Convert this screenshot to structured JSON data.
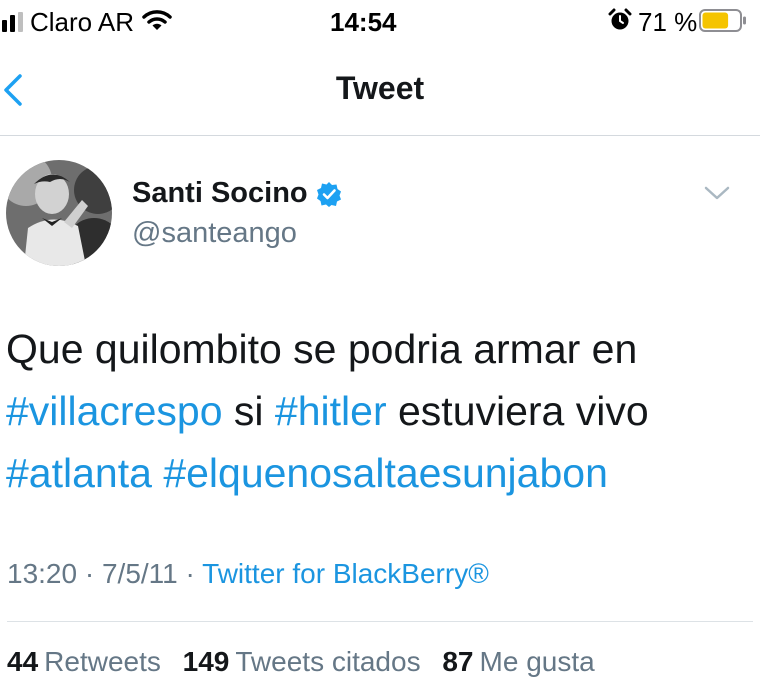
{
  "status_bar": {
    "carrier": "Claro AR",
    "time": "14:54",
    "battery_percent": "71 %",
    "battery_level": 0.71,
    "battery_color": "#f5c400",
    "icons": [
      "signal-icon",
      "wifi-icon",
      "alarm-icon",
      "battery-icon"
    ]
  },
  "nav": {
    "title": "Tweet",
    "back_icon": "chevron-left-icon",
    "accent": "#1da1f2"
  },
  "tweet": {
    "author_name": "Santi Socino",
    "verified": true,
    "handle": "@santeango",
    "text": {
      "line1": "Que quilombito se podria armar en",
      "hashtag_villacrespo": "#villacrespo",
      "word_si": "si",
      "hashtag_hitler": "#hitler",
      "rest_line2": "estuviera vivo",
      "hashtag_atlanta": "#atlanta",
      "hashtag_elqueno": "#elquenosaltaesunjabon"
    },
    "time": "13:20",
    "date": "7/5/11",
    "source": "Twitter for BlackBerry®",
    "hashtag_color": "#1b95e0"
  },
  "stats": {
    "retweets_count": "44",
    "retweets_label": "Retweets",
    "quotes_count": "149",
    "quotes_label": "Tweets citados",
    "likes_count": "87",
    "likes_label": "Me gusta"
  }
}
